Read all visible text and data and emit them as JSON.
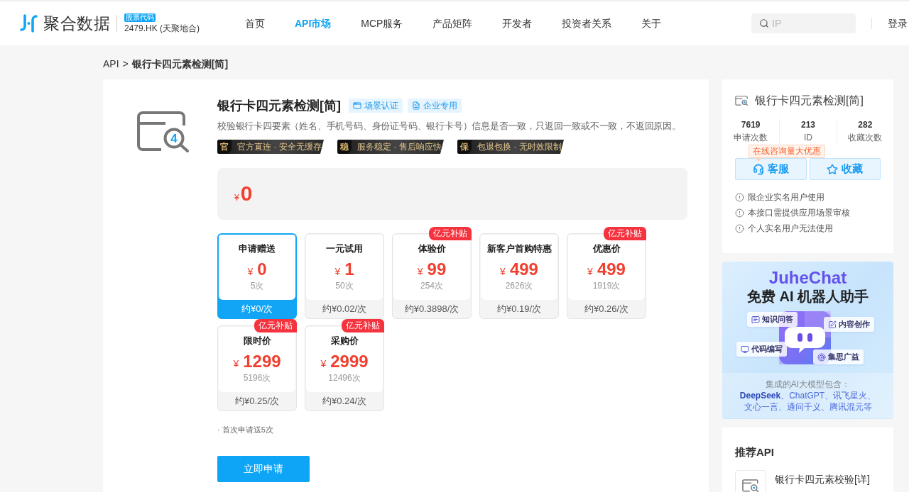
{
  "header": {
    "logo_text": "聚合数据",
    "stock_badge": "股票代码",
    "stock_code": "2479.HK (天聚地合)",
    "nav": [
      {
        "label": "首页",
        "selected": false
      },
      {
        "label": "API市场",
        "selected": true
      },
      {
        "label": "MCP服务",
        "selected": false
      },
      {
        "label": "产品矩阵",
        "selected": false
      },
      {
        "label": "开发者",
        "selected": false
      },
      {
        "label": "投资者关系",
        "selected": false
      },
      {
        "label": "关于",
        "selected": false
      }
    ],
    "search": {
      "placeholder": "IP"
    },
    "login": "登录"
  },
  "breadcrumb": {
    "root": "API",
    "separator": ">",
    "current": "银行卡四元素检测[简]"
  },
  "product": {
    "icon_digit": "4",
    "title": "银行卡四元素检测[简]",
    "tags": [
      {
        "kind": "scene",
        "label": "场景认证"
      },
      {
        "kind": "enterprise",
        "label": "企业专用"
      }
    ],
    "description": "校验银行卡四要素（姓名、手机号码、身份证号码、银行卡号）信息是否一致，只返回一致或不一致，不返回原因。",
    "guarantees": [
      {
        "mark": "官",
        "text": "官方直连 · 安全无缓存"
      },
      {
        "mark": "稳",
        "text": "服务稳定 · 售后响应快"
      },
      {
        "mark": "保",
        "text": "包退包换 · 无时效限制"
      }
    ],
    "price": {
      "currency": "¥",
      "amount": "0"
    },
    "plans": [
      {
        "title": "申请赠送",
        "currency": "¥",
        "price": "0",
        "count": "5次",
        "unit_price": "约¥0/次",
        "selected": true
      },
      {
        "title": "一元试用",
        "currency": "¥",
        "price": "1",
        "count": "50次",
        "unit_price": "约¥0.02/次",
        "selected": false
      },
      {
        "title": "体验价",
        "currency": "¥",
        "price": "99",
        "count": "254次",
        "unit_price": "约¥0.3898/次",
        "badge": "亿元补贴",
        "selected": false
      },
      {
        "title": "新客户首购特惠",
        "currency": "¥",
        "price": "499",
        "count": "2626次",
        "unit_price": "约¥0.19/次",
        "selected": false
      },
      {
        "title": "优惠价",
        "currency": "¥",
        "price": "499",
        "count": "1919次",
        "unit_price": "约¥0.26/次",
        "badge": "亿元补贴",
        "selected": false
      },
      {
        "title": "限时价",
        "currency": "¥",
        "price": "1299",
        "count": "5196次",
        "unit_price": "约¥0.25/次",
        "badge": "亿元补贴",
        "selected": false
      },
      {
        "title": "采购价",
        "currency": "¥",
        "price": "2999",
        "count": "12496次",
        "unit_price": "约¥0.24/次",
        "badge": "亿元补贴",
        "selected": false
      }
    ],
    "note": "· 首次申请送5次",
    "apply_button": "立即申请"
  },
  "sidebar": {
    "summary": {
      "title": "银行卡四元素检测[简]",
      "stats": [
        {
          "value": "7619",
          "label": "申请次数"
        },
        {
          "value": "213",
          "label": "ID"
        },
        {
          "value": "282",
          "label": "收藏次数"
        }
      ],
      "tooltip": "在线咨询量大优惠",
      "actions": [
        {
          "kind": "service",
          "label": "客服"
        },
        {
          "kind": "favorite",
          "label": "收藏"
        }
      ],
      "notices": [
        "限企业实名用户使用",
        "本接口需提供应用场景审核",
        "个人实名用户无法使用"
      ]
    },
    "banner": {
      "brand": "JuheChat",
      "headline": "免费 AI 机器人助手",
      "features": [
        {
          "kind": "qa",
          "label": "知识问答"
        },
        {
          "kind": "create",
          "label": "内容创作"
        },
        {
          "kind": "code",
          "label": "代码编写"
        },
        {
          "kind": "ideas",
          "label": "集思广益"
        }
      ],
      "models_label": "集成的AI大模型包含：",
      "models": [
        "**DeepSeek**、ChatGPT、讯飞星火、",
        "文心一言、通问千义、腾讯混元等"
      ]
    },
    "recommended": {
      "title": "推荐API",
      "items": [
        {
          "name": "银行卡四元素校验[详]"
        }
      ]
    }
  }
}
